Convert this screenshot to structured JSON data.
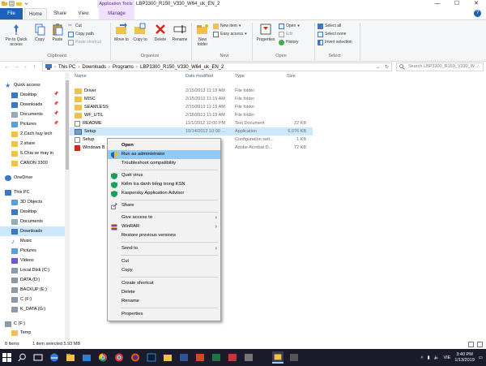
{
  "titlebar": {
    "title": "LBP3300_R150_V330_W64_uk_EN_2",
    "contextual_tab_label": "Application Tools",
    "minimize": "—",
    "maximize": "☐",
    "close": "✕"
  },
  "tabs": {
    "file": "File",
    "home": "Home",
    "share": "Share",
    "view": "View",
    "manage": "Manage",
    "help": "?"
  },
  "ribbon": {
    "clipboard": {
      "group_label": "Clipboard",
      "pin": "Pin to Quick access",
      "copy": "Copy",
      "paste": "Paste",
      "cut": "Cut",
      "copy_path": "Copy path",
      "paste_shortcut": "Paste shortcut"
    },
    "organize": {
      "group_label": "Organize",
      "move_to": "Move to",
      "copy_to": "Copy to",
      "delete": "Delete",
      "rename": "Rename"
    },
    "new": {
      "group_label": "New",
      "new_folder": "New folder",
      "new_item": "New item",
      "easy_access": "Easy access"
    },
    "open": {
      "group_label": "Open",
      "properties": "Properties",
      "open": "Open",
      "edit": "Edit",
      "history": "History"
    },
    "select": {
      "group_label": "Select",
      "select_all": "Select all",
      "select_none": "Select none",
      "invert_selection": "Invert selection"
    }
  },
  "address": {
    "crumbs": [
      "This PC",
      "Downloads",
      "Programs",
      "LBP3300_R150_V330_W64_uk_EN_2"
    ],
    "search_placeholder": "Search LBP3300_R150_V330_W..."
  },
  "nav": {
    "items": [
      {
        "label": "Quick access"
      },
      {
        "label": "Desktop"
      },
      {
        "label": "Downloads"
      },
      {
        "label": "Documents"
      },
      {
        "label": "Pictures"
      },
      {
        "label": "2.Cach huy lech"
      },
      {
        "label": "2.share"
      },
      {
        "label": "5.Chia se may in"
      },
      {
        "label": "CANON 3300"
      },
      {
        "label": "OneDrive"
      },
      {
        "label": "This PC"
      },
      {
        "label": "3D Objects"
      },
      {
        "label": "Desktop"
      },
      {
        "label": "Documents"
      },
      {
        "label": "Downloads"
      },
      {
        "label": "Music"
      },
      {
        "label": "Pictures"
      },
      {
        "label": "Videos"
      },
      {
        "label": "Local Disk (C:)"
      },
      {
        "label": "DATA (D:)"
      },
      {
        "label": "BACKUP (E:)"
      },
      {
        "label": "C (F:)"
      },
      {
        "label": "K_DATA (G:)"
      },
      {
        "label": "C (F:)"
      },
      {
        "label": "Temp"
      }
    ]
  },
  "files": {
    "headers": {
      "name": "Name",
      "date": "Date modified",
      "type": "Type",
      "size": "Size"
    },
    "rows": [
      {
        "name": "Driver",
        "date": "2/15/2013 11:19 AM",
        "type": "File folder",
        "size": ""
      },
      {
        "name": "MISC",
        "date": "2/15/2013 11:19 AM",
        "type": "File folder",
        "size": ""
      },
      {
        "name": "SEAMLESS",
        "date": "2/15/2013 11:19 AM",
        "type": "File folder",
        "size": ""
      },
      {
        "name": "WF_UTIL",
        "date": "2/15/2013 11:19 AM",
        "type": "File folder",
        "size": ""
      },
      {
        "name": "README",
        "date": "11/1/2012 10:00 PM",
        "type": "Text Document",
        "size": "22 KB"
      },
      {
        "name": "Setup",
        "date": "10/14/2012 10:00 ...",
        "type": "Application",
        "size": "6,076 KB"
      },
      {
        "name": "Setup",
        "date": "",
        "type": "Configuration sett...",
        "size": "1 KB"
      },
      {
        "name": "Windows B",
        "date": "",
        "type": "Adobe Acrobat D...",
        "size": "72 KB"
      }
    ]
  },
  "context_menu": {
    "open": "Open",
    "run_as_admin": "Run as administrator",
    "troubleshoot": "Troubleshoot compatibility",
    "quet_virus": "Quét virus",
    "kiem_tra": "Kiểm tra danh tiếng trong KSN",
    "kaspersky": "Kaspersky Application Advisor",
    "share": "Share",
    "give_access": "Give access to",
    "winrar": "WinRAR",
    "restore": "Restore previous versions",
    "send_to": "Send to",
    "cut": "Cut",
    "copy": "Copy",
    "create_shortcut": "Create shortcut",
    "delete": "Delete",
    "rename": "Rename",
    "properties": "Properties"
  },
  "status": {
    "items": "8 items",
    "selected": "1 item selected  5.93 MB"
  },
  "taskbar": {
    "lang": "VIE",
    "time": "3:40 PM",
    "date": "1/13/2019"
  },
  "colors": {
    "accent": "#1c63b7",
    "selection": "#cce8ff",
    "menu_highlight": "#91c9f7",
    "taskbar": "#1b1b2b",
    "contextual_tab": "#f0e1ff"
  }
}
